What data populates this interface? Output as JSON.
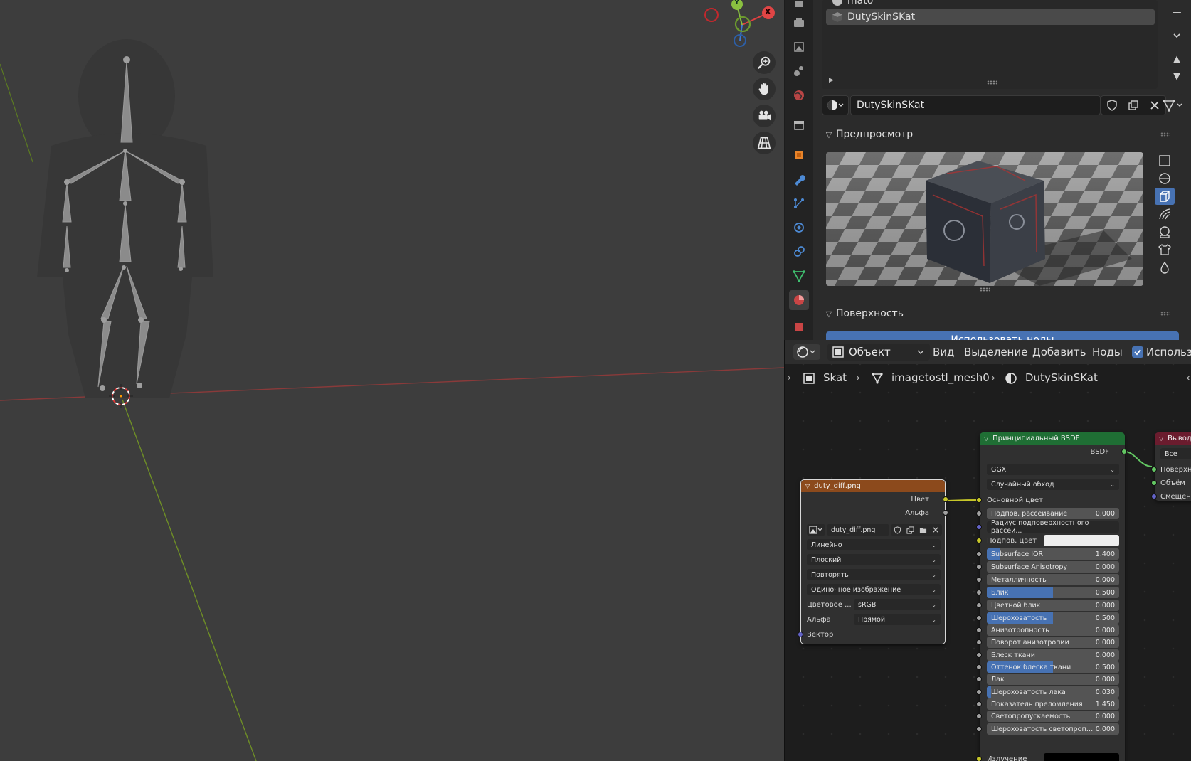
{
  "properties": {
    "material_slots": [
      {
        "label": "mato",
        "selected": false
      },
      {
        "label": "DutySkinSKat",
        "selected": true
      }
    ],
    "material_name": "DutySkinSKat",
    "panels": {
      "preview": "Предпросмотр",
      "surface": "Поверхность",
      "use_nodes_button": "Использовать ноды"
    }
  },
  "node_editor": {
    "header": {
      "mode_select": "Объект",
      "menus": [
        "Вид",
        "Выделение",
        "Добавить",
        "Ноды"
      ],
      "use_nodes_checkbox": "Использо"
    },
    "breadcrumb": {
      "object": "Skat",
      "mesh": "imagetostl_mesh0",
      "material": "DutySkinSKat"
    },
    "image_node": {
      "title": "duty_diff.png",
      "outputs": [
        "Цвет",
        "Альфа"
      ],
      "image_name": "duty_diff.png",
      "interpolation": "Линейно",
      "projection": "Плоский",
      "extension": "Повторять",
      "source": "Одиночное изображение",
      "color_space_label": "Цветовое ...",
      "color_space_value": "sRGB",
      "alpha_label": "Альфа",
      "alpha_value": "Прямой",
      "vector_input": "Вектор"
    },
    "bsdf_node": {
      "title": "Принципиальный BSDF",
      "output": "BSDF",
      "distribution": "GGX",
      "subsurface_method": "Случайный обход",
      "base_color_label": "Основной цвет",
      "subsurface_radius_label": "Радиус подповерхностного рассеи...",
      "subsurface_color_label": "Подпов. цвет",
      "emission_label": "Излучение",
      "fields": [
        {
          "label": "Подпов. рассеивание",
          "value": "0.000",
          "fill": 0.0
        },
        {
          "label": "Subsurface IOR",
          "value": "1.400",
          "fill": 0.1
        },
        {
          "label": "Subsurface Anisotropy",
          "value": "0.000",
          "fill": 0.0
        },
        {
          "label": "Металличность",
          "value": "0.000",
          "fill": 0.0
        },
        {
          "label": "Блик",
          "value": "0.500",
          "fill": 0.5
        },
        {
          "label": "Цветной блик",
          "value": "0.000",
          "fill": 0.0
        },
        {
          "label": "Шероховатость",
          "value": "0.500",
          "fill": 0.5
        },
        {
          "label": "Анизотропность",
          "value": "0.000",
          "fill": 0.0
        },
        {
          "label": "Поворот анизотропии",
          "value": "0.000",
          "fill": 0.0
        },
        {
          "label": "Блеск ткани",
          "value": "0.000",
          "fill": 0.0
        },
        {
          "label": "Оттенок блеска ткани",
          "value": "0.500",
          "fill": 0.5
        },
        {
          "label": "Лак",
          "value": "0.000",
          "fill": 0.0
        },
        {
          "label": "Шероховатость лака",
          "value": "0.030",
          "fill": 0.03
        },
        {
          "label": "Показатель преломления",
          "value": "1.450",
          "fill": 0.0
        },
        {
          "label": "Светопропускаемость",
          "value": "0.000",
          "fill": 0.0
        },
        {
          "label": "Шероховатость светопропуск",
          "value": "0.000",
          "fill": 0.0
        }
      ]
    },
    "output_node": {
      "title": "Вывод",
      "target": "Все",
      "inputs": [
        "Поверхность",
        "Объём",
        "Смещение"
      ]
    }
  },
  "viewport": {
    "gizmo_axes": [
      "X",
      "Y"
    ]
  }
}
